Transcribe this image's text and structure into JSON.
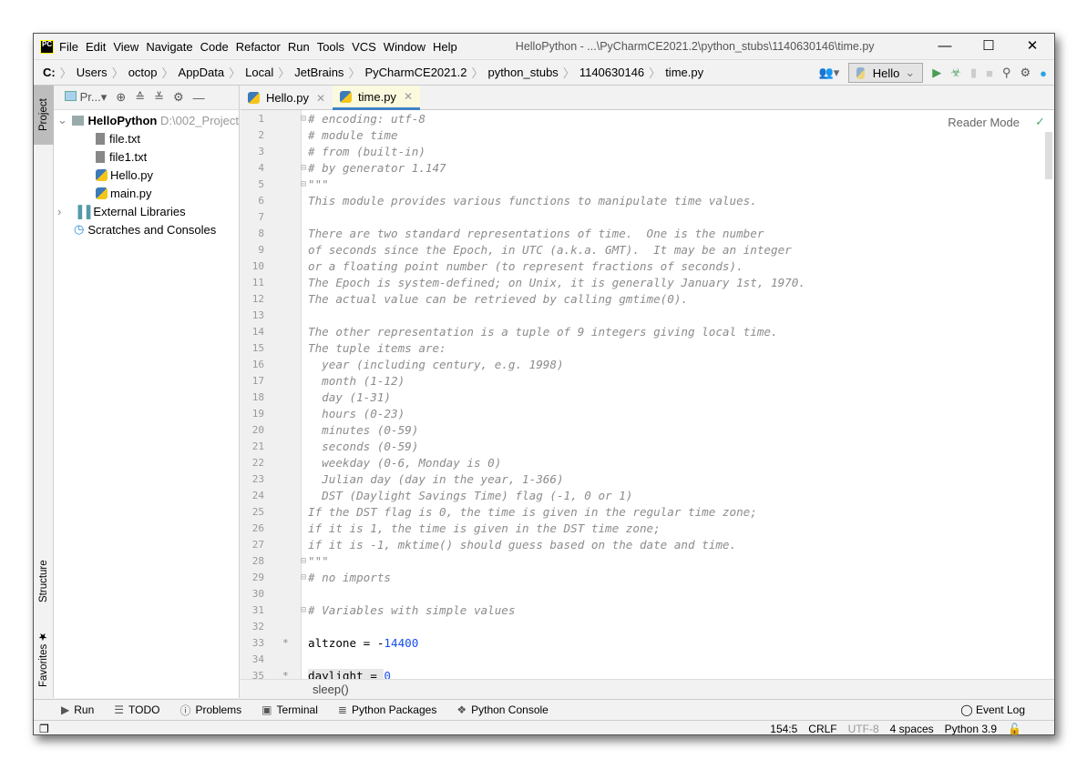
{
  "titlebar": {
    "logo": "PC",
    "menu": [
      "File",
      "Edit",
      "View",
      "Navigate",
      "Code",
      "Refactor",
      "Run",
      "Tools",
      "VCS",
      "Window",
      "Help"
    ],
    "title": "HelloPython - ...\\PyCharmCE2021.2\\python_stubs\\1140630146\\time.py"
  },
  "navbar": {
    "breadcrumb": [
      "C:",
      "Users",
      "octop",
      "AppData",
      "Local",
      "JetBrains",
      "PyCharmCE2021.2",
      "python_stubs",
      "1140630146",
      "time.py"
    ],
    "run_config": "Hello"
  },
  "sidebar_tabs": {
    "project": "Project",
    "structure": "Structure",
    "favorites": "Favorites"
  },
  "project": {
    "dropdown": "Pr...",
    "root": "HelloPython",
    "root_path": "D:\\002_Project",
    "files": [
      "file.txt",
      "file1.txt",
      "Hello.py",
      "main.py"
    ],
    "external": "External Libraries",
    "scratches": "Scratches and Consoles"
  },
  "tabs": [
    {
      "label": "Hello.py",
      "active": false
    },
    {
      "label": "time.py",
      "active": true
    }
  ],
  "editor": {
    "reader_mode": "Reader Mode",
    "breadcrumb": "sleep()",
    "lines": [
      {
        "t": "cm",
        "s": "# encoding: utf-8",
        "f": "⊟"
      },
      {
        "t": "cm",
        "s": "# module time"
      },
      {
        "t": "cm",
        "s": "# from (built-in)"
      },
      {
        "t": "cm",
        "s": "# by generator 1.147",
        "f": "⊟"
      },
      {
        "t": "cm",
        "s": "\"\"\"",
        "f": "⊟"
      },
      {
        "t": "cm",
        "s": "This module provides various functions to manipulate time values."
      },
      {
        "t": "cm",
        "s": ""
      },
      {
        "t": "cm",
        "s": "There are two standard representations of time.  One is the number"
      },
      {
        "t": "cm",
        "s": "of seconds since the Epoch, in UTC (a.k.a. GMT).  It may be an integer"
      },
      {
        "t": "cm",
        "s": "or a floating point number (to represent fractions of seconds)."
      },
      {
        "t": "cm",
        "s": "The Epoch is system-defined; on Unix, it is generally January 1st, 1970."
      },
      {
        "t": "cm",
        "s": "The actual value can be retrieved by calling gmtime(0)."
      },
      {
        "t": "cm",
        "s": ""
      },
      {
        "t": "cm",
        "s": "The other representation is a tuple of 9 integers giving local time."
      },
      {
        "t": "cm",
        "s": "The tuple items are:"
      },
      {
        "t": "cm",
        "s": "  year (including century, e.g. 1998)"
      },
      {
        "t": "cm",
        "s": "  month (1-12)"
      },
      {
        "t": "cm",
        "s": "  day (1-31)"
      },
      {
        "t": "cm",
        "s": "  hours (0-23)"
      },
      {
        "t": "cm",
        "s": "  minutes (0-59)"
      },
      {
        "t": "cm",
        "s": "  seconds (0-59)"
      },
      {
        "t": "cm",
        "s": "  weekday (0-6, Monday is 0)"
      },
      {
        "t": "cm",
        "s": "  Julian day (day in the year, 1-366)"
      },
      {
        "t": "cm",
        "s": "  DST (Daylight Savings Time) flag (-1, 0 or 1)"
      },
      {
        "t": "cm",
        "s": "If the DST flag is 0, the time is given in the regular time zone;"
      },
      {
        "t": "cm",
        "s": "if it is 1, the time is given in the DST time zone;"
      },
      {
        "t": "cm",
        "s": "if it is -1, mktime() should guess based on the date and time."
      },
      {
        "t": "cm",
        "s": "\"\"\"",
        "f": "⊟"
      },
      {
        "t": "cm",
        "s": "# no imports",
        "f": "⊟"
      },
      {
        "t": "cm",
        "s": ""
      },
      {
        "t": "cm",
        "s": "# Variables with simple values",
        "f": "⊟"
      },
      {
        "t": "cm",
        "s": ""
      },
      {
        "t": "code",
        "s": "altzone = -",
        "n": "14400",
        "m": "*"
      },
      {
        "t": "cm",
        "s": ""
      },
      {
        "t": "code",
        "s": "daylight = ",
        "n": "0",
        "m": "*",
        "hl": true
      }
    ]
  },
  "toolwindows": [
    "Run",
    "TODO",
    "Problems",
    "Terminal",
    "Python Packages",
    "Python Console"
  ],
  "event_log": "Event Log",
  "status": {
    "position": "154:5",
    "line_sep": "CRLF",
    "encoding": "UTF-8",
    "indent": "4 spaces",
    "interpreter": "Python 3.9"
  }
}
